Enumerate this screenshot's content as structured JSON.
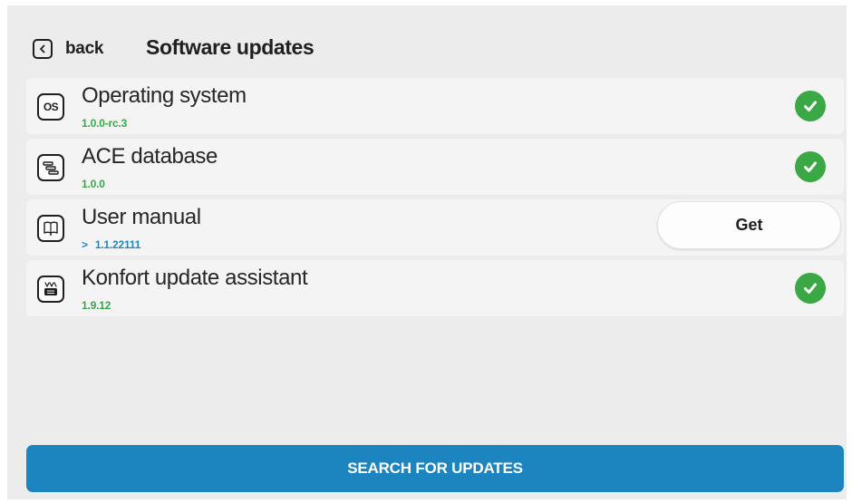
{
  "header": {
    "back_label": "back",
    "title": "Software updates"
  },
  "items": [
    {
      "icon": "os-icon",
      "icon_text": "OS",
      "title": "Operating system",
      "version": "1.0.0-rc.3",
      "status": "up-to-date",
      "status_icon": "check-circle-icon"
    },
    {
      "icon": "database-icon",
      "title": "ACE database",
      "version": "1.0.0",
      "status": "up-to-date",
      "status_icon": "check-circle-icon"
    },
    {
      "icon": "manual-icon",
      "title": "User manual",
      "version_prefix": ">",
      "version": "1.1.22111",
      "status": "update-available",
      "action_label": "Get"
    },
    {
      "icon": "update-assistant-icon",
      "title": "Konfort update assistant",
      "version": "1.9.12",
      "status": "up-to-date",
      "status_icon": "check-circle-icon"
    }
  ],
  "footer": {
    "search_label": "SEARCH FOR UPDATES"
  },
  "colors": {
    "background": "#ececec",
    "row_background": "#f4f4f4",
    "installed_version": "#3aa648",
    "available_version": "#1f87c2",
    "check_green": "#39a845",
    "primary_button": "#1c84bf"
  }
}
